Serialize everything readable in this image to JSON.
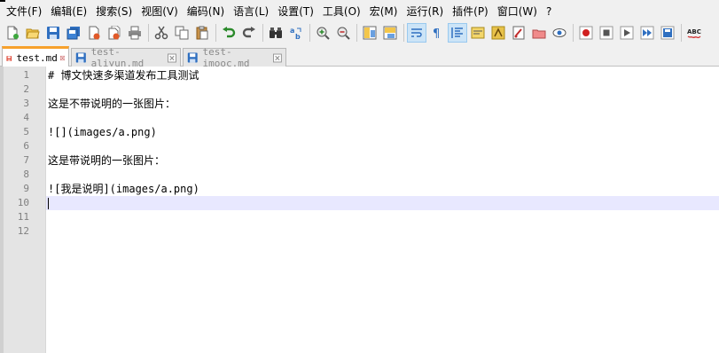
{
  "menu": {
    "items": [
      "文件(F)",
      "编辑(E)",
      "搜索(S)",
      "视图(V)",
      "编码(N)",
      "语言(L)",
      "设置(T)",
      "工具(O)",
      "宏(M)",
      "运行(R)",
      "插件(P)",
      "窗口(W)",
      "?"
    ]
  },
  "toolbar": {
    "icons": [
      "new-file-icon",
      "open-file-icon",
      "save-icon",
      "save-all-icon",
      "close-icon",
      "close-all-icon",
      "print-icon",
      "cut-icon",
      "copy-icon",
      "paste-icon",
      "undo-icon",
      "redo-icon",
      "find-icon",
      "replace-icon",
      "zoom-in-icon",
      "zoom-out-icon",
      "sync-vertical-icon",
      "sync-horizontal-icon",
      "word-wrap-icon",
      "show-all-chars-icon",
      "indent-guide-icon",
      "doc-map-icon",
      "function-list-icon",
      "folder-as-workspace-icon",
      "doc-switcher-icon",
      "monitoring-icon",
      "record-macro-icon",
      "stop-record-icon",
      "play-macro-icon",
      "run-macro-multiple-icon",
      "save-macro-icon",
      "spell-check-icon"
    ],
    "spellcheck_label": "ABC"
  },
  "tabs": [
    {
      "label": "test.md",
      "state": "active"
    },
    {
      "label": "test-aliyun.md",
      "state": "inactive"
    },
    {
      "label": "test-imooc.md",
      "state": "inactive"
    }
  ],
  "editor": {
    "line_numbers": [
      "1",
      "2",
      "3",
      "4",
      "5",
      "6",
      "7",
      "8",
      "9",
      "10",
      "11",
      "12"
    ],
    "lines": [
      "# 博文快速多渠道发布工具测试",
      "",
      "这是不带说明的一张图片：",
      "",
      "![](images/a.png)",
      "",
      "这是带说明的一张图片：",
      "",
      "![我是说明](images/a.png)",
      "",
      "",
      ""
    ],
    "current_line": "10"
  },
  "colors": {
    "accent_tab": "#f7a12c",
    "current_line": "#e8e8ff",
    "gutter": "#e4e4e4"
  }
}
